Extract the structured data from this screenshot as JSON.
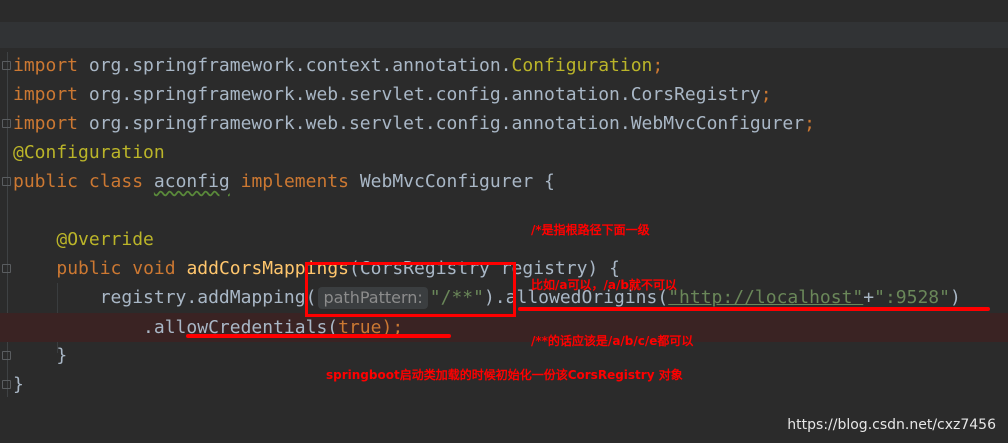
{
  "code": {
    "lines": [
      {
        "kw": "import",
        "path": " org.springframework.context.annotation.",
        "cls": "Configuration",
        "semi": ";"
      },
      {
        "kw": "import",
        "path": " org.springframework.web.servlet.config.annotation.",
        "cls": "CorsRegistry",
        "semi": ";"
      },
      {
        "kw": "import",
        "path": " org.springframework.web.servlet.config.annotation.",
        "cls": "WebMvcConfigurer",
        "semi": ";"
      }
    ],
    "annotation_config": "@Configuration",
    "class_decl": {
      "public": "public",
      "class": "class",
      "name": "aconfig",
      "implements": "implements",
      "iface": "WebMvcConfigurer",
      "brace": " {"
    },
    "override": "@Override",
    "method_decl": {
      "public": "public",
      "void": "void",
      "name": "addCorsMappings",
      "params": "(CorsRegistry registry) {"
    },
    "call_line": {
      "prefix": "registry.addMapping(",
      "hint": "pathPattern:",
      "arg": "\"/**\"",
      "mid": ").allowedOrigins(",
      "url": "\"http://localhost\"",
      "plus": "+",
      "port": "\":9528\"",
      "close": ")"
    },
    "chain_line": {
      "prefix": ".allowCredentials(",
      "val": "true",
      "close": ");"
    },
    "close_method": "}",
    "close_class": "}"
  },
  "notes": {
    "root_path": "/*是指根路径下面一级",
    "example": "比如/a可以，/a/b就不可以",
    "double_star": "/**的话应该是/a/b/c/e都可以",
    "springboot": "springboot启动类加载的时候初始化一份该CorsRegistry 对象"
  },
  "watermark": "https://blog.csdn.net/cxz7456",
  "colors": {
    "background": "#2b2b2b",
    "keyword": "#cc7832",
    "annotation": "#bbb529",
    "method": "#ffc66d",
    "string": "#6a8759",
    "note": "#ff0000"
  }
}
